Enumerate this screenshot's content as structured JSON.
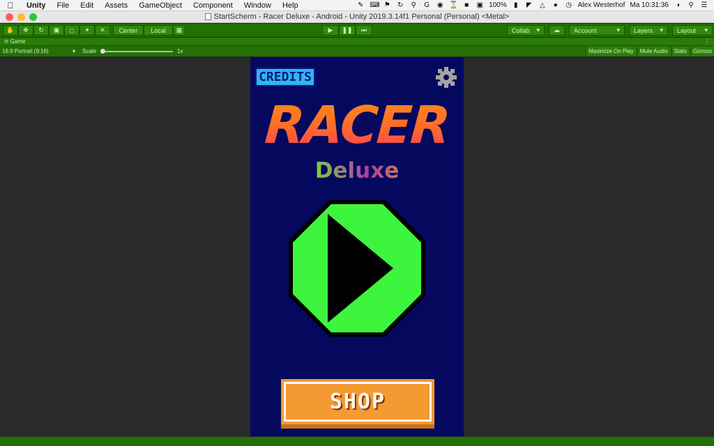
{
  "menubar": {
    "app_name": "Unity",
    "items": [
      "File",
      "Edit",
      "Assets",
      "GameObject",
      "Component",
      "Window",
      "Help"
    ],
    "battery": "100%",
    "user": "Alex Westerhof",
    "clock": "Ma 10:31:36"
  },
  "window": {
    "title": "StartScherm - Racer Deluxe - Android - Unity 2019.3.14f1 Personal (Personal) <Metal>",
    "light_colors": [
      "#fe5f57",
      "#febc2e",
      "#28c840"
    ]
  },
  "toolbar": {
    "pivot": "Center",
    "space": "Local",
    "collab": "Collab",
    "account": "Account",
    "layers": "Layers",
    "layout": "Layout"
  },
  "game_view": {
    "tab": "Game",
    "aspect": "16:9 Portrait (9:16)",
    "scale_label": "Scale",
    "scale_value": "1x",
    "options": [
      "Maximize On Play",
      "Mute Audio",
      "Stats",
      "Gizmos"
    ]
  },
  "game": {
    "credits_label": "CREDITS",
    "title": "RACER",
    "subtitle": "Deluxe",
    "shop_label": "SHOP",
    "colors": {
      "background": "#05095e",
      "play_fill": "#3ef53e",
      "shop_fill": "#f39a32",
      "credits_fill": "#2fb6f0"
    }
  }
}
